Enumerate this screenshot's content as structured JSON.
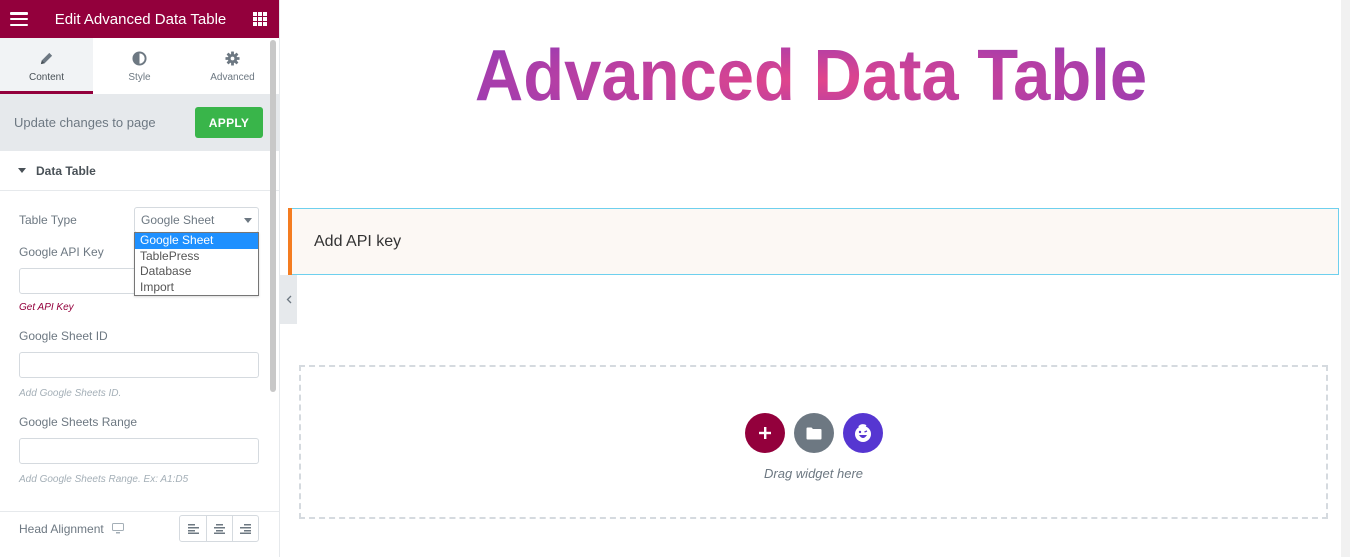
{
  "panel": {
    "title": "Edit Advanced Data Table",
    "tabs": [
      {
        "label": "Content",
        "icon": "pencil-icon",
        "active": true
      },
      {
        "label": "Style",
        "icon": "half-circle-icon",
        "active": false
      },
      {
        "label": "Advanced",
        "icon": "gear-icon",
        "active": false
      }
    ],
    "update_bar": {
      "message": "Update changes to page",
      "apply_label": "APPLY"
    },
    "section": {
      "title": "Data Table",
      "expanded": true
    },
    "controls": {
      "table_type": {
        "label": "Table Type",
        "value": "Google Sheet",
        "options": [
          "Google Sheet",
          "TablePress",
          "Database",
          "Import"
        ],
        "dropdown_open": true
      },
      "api_key": {
        "label": "Google API Key",
        "value": "",
        "link": "Get API Key"
      },
      "sheet_id": {
        "label": "Google Sheet ID",
        "value": "",
        "help": "Add Google Sheets ID."
      },
      "sheet_range": {
        "label": "Google Sheets Range",
        "value": "",
        "help": "Add Google Sheets Range. Ex: A1:D5"
      },
      "head_alignment": {
        "label": "Head Alignment",
        "device_icon": "desktop-icon",
        "options": [
          "left",
          "center",
          "right"
        ]
      }
    }
  },
  "preview": {
    "title": "Advanced Data Table",
    "notice": "Add API key",
    "drop_zone": {
      "text": "Drag widget here",
      "buttons": [
        "add-section",
        "template-library",
        "emoji-widget"
      ]
    }
  },
  "colors": {
    "brand": "#93003c",
    "apply": "#39b54a",
    "notice_border": "#f47c20",
    "notice_outline": "#6ed0ee",
    "smiley": "#5636d1"
  }
}
